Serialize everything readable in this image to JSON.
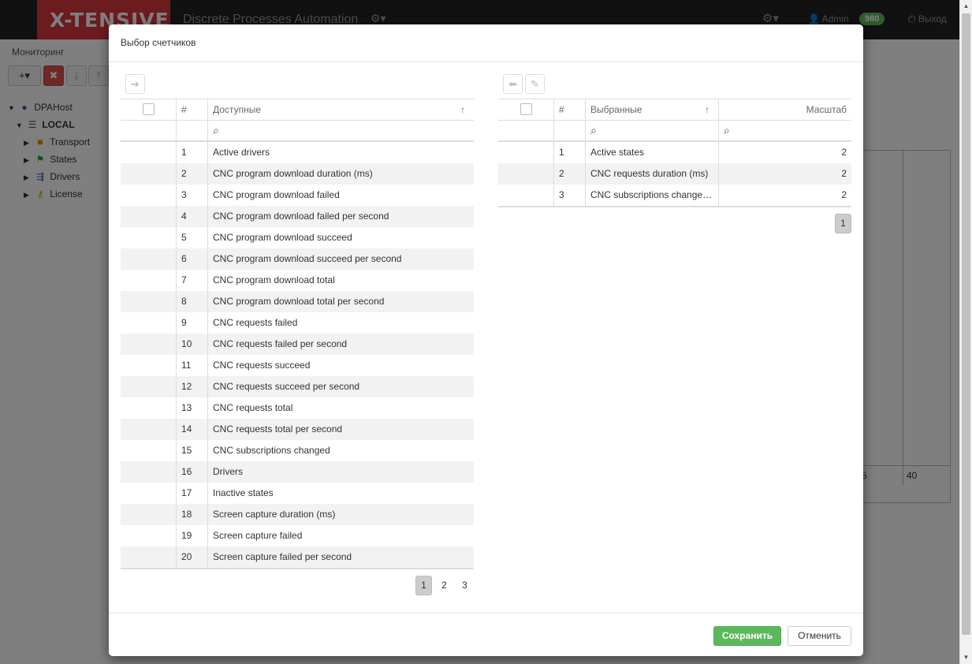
{
  "app": {
    "brand": "X-TENSIVE",
    "title": "Discrete Processes Automation",
    "user": "Admin",
    "badge": "980",
    "logout": "Выход",
    "page_label": "Мониторинг"
  },
  "toolbar": {
    "add": "+▾",
    "delete": "✖",
    "download": "⤓",
    "upload": "⤒"
  },
  "tree": {
    "root": "DPAHost",
    "local": "LOCAL",
    "items": [
      "Transport",
      "States",
      "Drivers",
      "License"
    ]
  },
  "background": {
    "num_left": "5",
    "num_right": "40"
  },
  "modal": {
    "title": "Выбор счетчиков",
    "save": "Сохранить",
    "cancel": "Отменить"
  },
  "available": {
    "col_num": "#",
    "col_name": "Доступные",
    "rows": [
      {
        "n": "1",
        "name": "Active drivers"
      },
      {
        "n": "2",
        "name": "CNC program download duration (ms)"
      },
      {
        "n": "3",
        "name": "CNC program download failed"
      },
      {
        "n": "4",
        "name": "CNC program download failed per second"
      },
      {
        "n": "5",
        "name": "CNC program download succeed"
      },
      {
        "n": "6",
        "name": "CNC program download succeed per second"
      },
      {
        "n": "7",
        "name": "CNC program download total"
      },
      {
        "n": "8",
        "name": "CNC program download total per second"
      },
      {
        "n": "9",
        "name": "CNC requests failed"
      },
      {
        "n": "10",
        "name": "CNC requests failed per second"
      },
      {
        "n": "11",
        "name": "CNC requests succeed"
      },
      {
        "n": "12",
        "name": "CNC requests succeed per second"
      },
      {
        "n": "13",
        "name": "CNC requests total"
      },
      {
        "n": "14",
        "name": "CNC requests total per second"
      },
      {
        "n": "15",
        "name": "CNC subscriptions changed"
      },
      {
        "n": "16",
        "name": "Drivers"
      },
      {
        "n": "17",
        "name": "Inactive states"
      },
      {
        "n": "18",
        "name": "Screen capture duration (ms)"
      },
      {
        "n": "19",
        "name": "Screen capture failed"
      },
      {
        "n": "20",
        "name": "Screen capture failed per second"
      }
    ],
    "pages": [
      "1",
      "2",
      "3"
    ]
  },
  "selected": {
    "col_num": "#",
    "col_name": "Выбранные",
    "col_scale": "Масштаб",
    "rows": [
      {
        "n": "1",
        "name": "Active states",
        "scale": "2"
      },
      {
        "n": "2",
        "name": "CNC requests duration (ms)",
        "scale": "2"
      },
      {
        "n": "3",
        "name": "CNC subscriptions changed ...",
        "scale": "2"
      }
    ],
    "pages": [
      "1"
    ]
  },
  "colors": {
    "brand": "#d9363e",
    "save": "#5cb85c",
    "badge": "#5cb85c"
  }
}
